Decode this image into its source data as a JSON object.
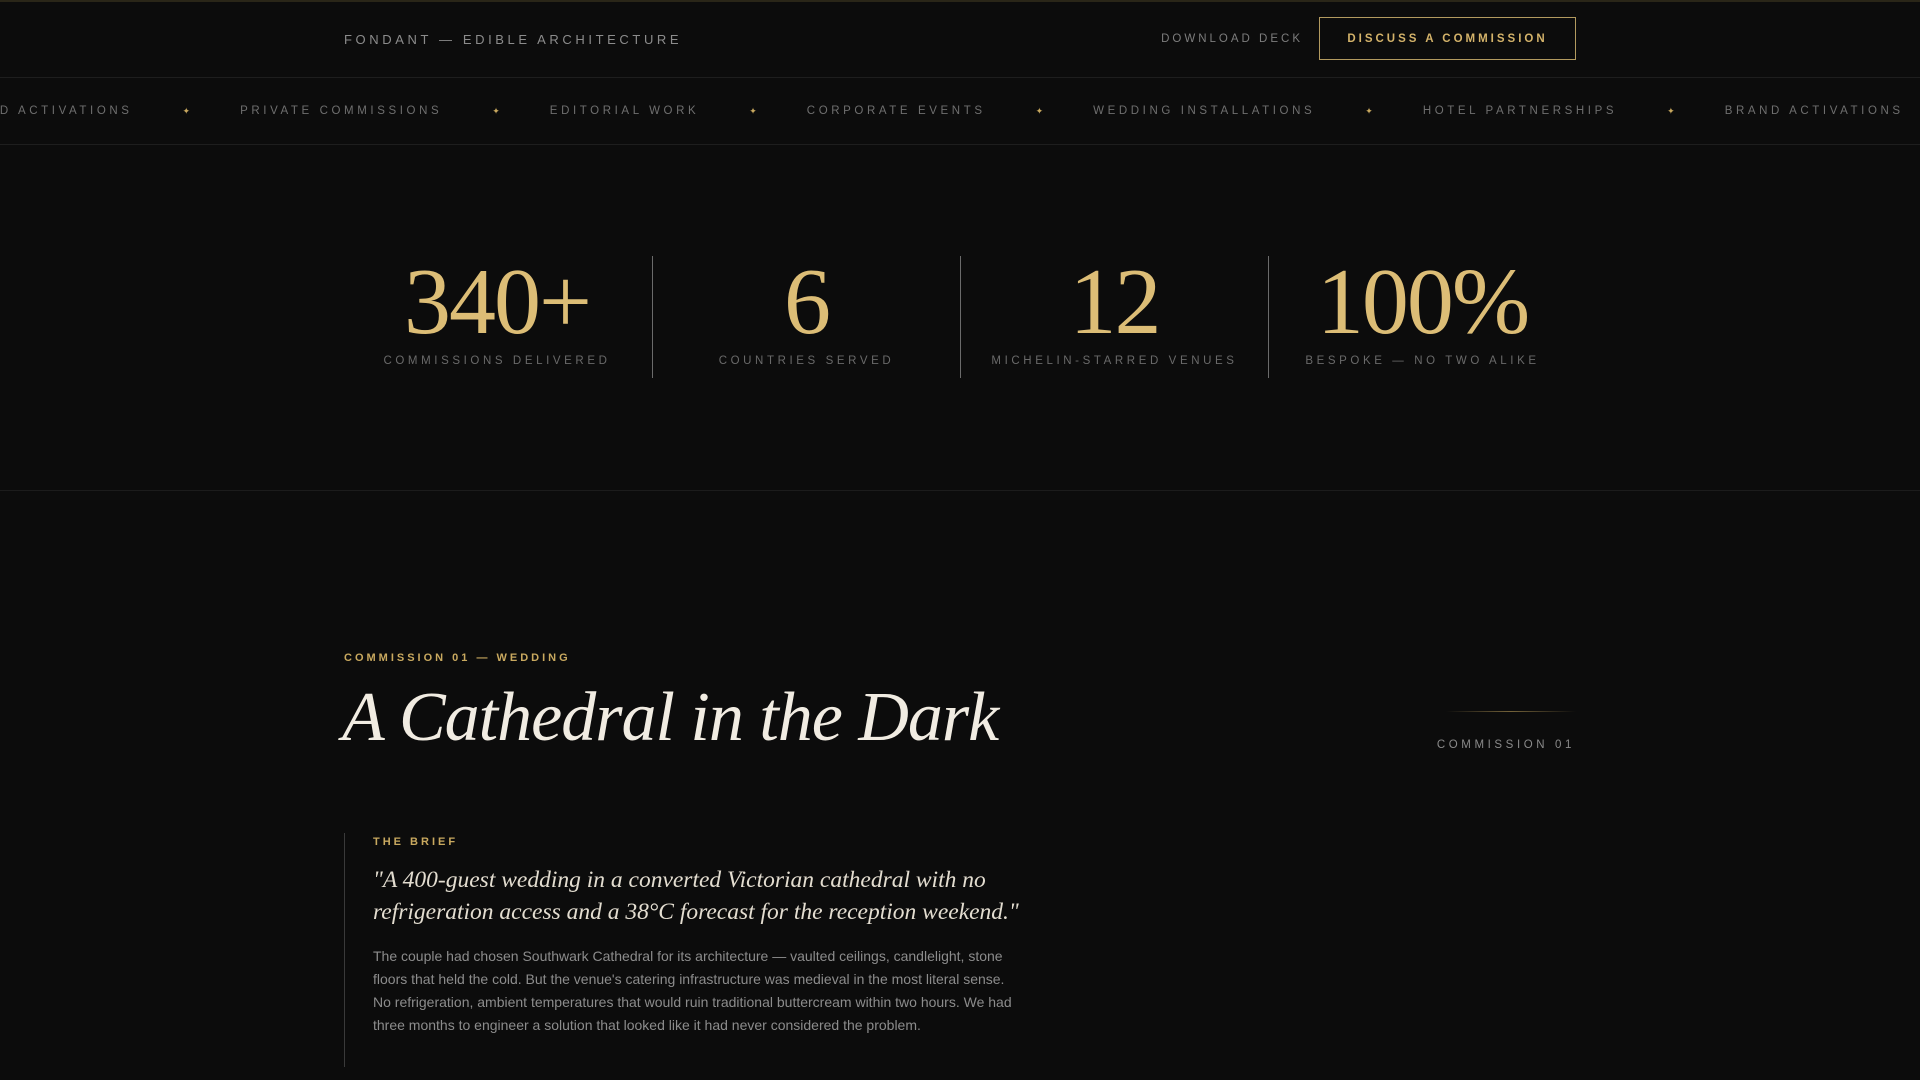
{
  "header": {
    "brand": "FONDANT — EDIBLE ARCHITECTURE",
    "download_label": "DOWNLOAD DECK",
    "cta_label": "DISCUSS A COMMISSION"
  },
  "ticker": {
    "items": [
      "ND ACTIVATIONS",
      "PRIVATE COMMISSIONS",
      "EDITORIAL WORK",
      "CORPORATE EVENTS",
      "WEDDING INSTALLATIONS",
      "HOTEL PARTNERSHIPS",
      "BRAND ACTIVATIONS"
    ],
    "separator": "✦"
  },
  "stats": [
    {
      "value": "340+",
      "label": "COMMISSIONS DELIVERED"
    },
    {
      "value": "6",
      "label": "COUNTRIES SERVED"
    },
    {
      "value": "12",
      "label": "MICHELIN-STARRED VENUES"
    },
    {
      "value": "100%",
      "label": "BESPOKE — NO TWO ALIKE"
    }
  ],
  "commission": {
    "eyebrow": "COMMISSION 01 — WEDDING",
    "title": "A Cathedral in the Dark",
    "side_label": "COMMISSION 01",
    "brief_label": "THE BRIEF",
    "quote": "\"A 400-guest wedding in a converted Victorian cathedral with no refrigeration access and a 38°C forecast for the reception weekend.\"",
    "body": "The couple had chosen Southwark Cathedral for its architecture — vaulted ceilings, candlelight, stone floors that held the cold. But the venue's catering infrastructure was medieval in the most literal sense. No refrigeration, ambient temperatures that would ruin traditional buttercream within two hours. We had three months to engineer a solution that looked like it had never considered the problem."
  },
  "colors": {
    "background": "#0c0c0c",
    "accent_gold": "#dcbd76",
    "muted_text": "#6f6f6f"
  }
}
